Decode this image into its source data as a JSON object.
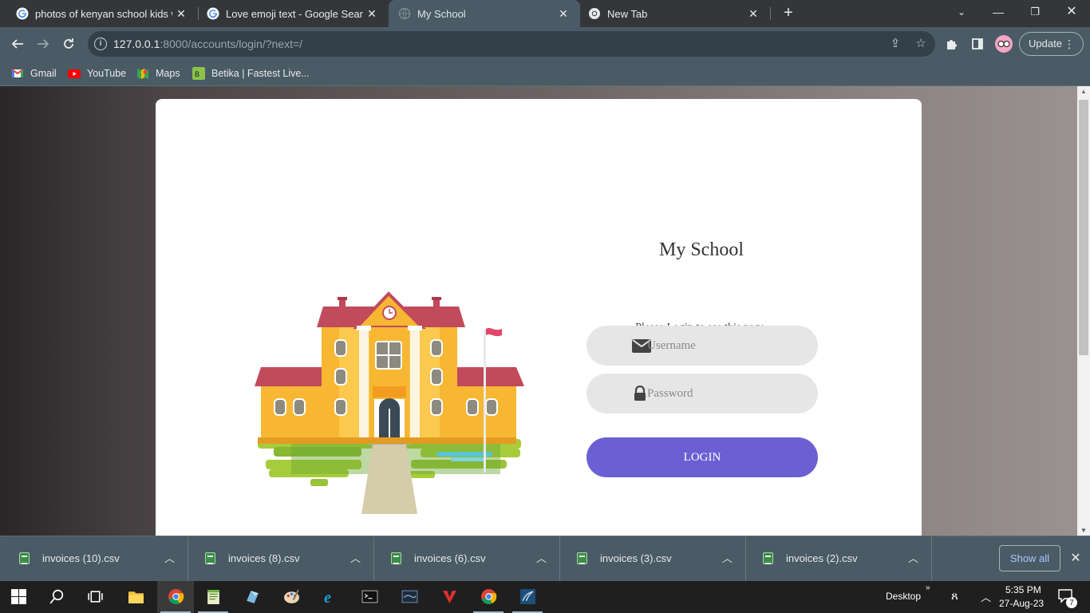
{
  "browser": {
    "tabs": [
      {
        "title": "photos of kenyan school kids wit",
        "favicon": "google-icon",
        "active": false
      },
      {
        "title": "Love emoji text - Google Search",
        "favicon": "google-icon",
        "active": false
      },
      {
        "title": "My School",
        "favicon": "globe-icon",
        "active": true
      },
      {
        "title": "New Tab",
        "favicon": "chrome-icon",
        "active": false
      }
    ],
    "url_host": "127.0.0.1",
    "url_path": ":8000/accounts/login/?next=/",
    "update_label": "Update",
    "bookmarks": [
      {
        "label": "Gmail",
        "icon": "gmail-icon"
      },
      {
        "label": "YouTube",
        "icon": "youtube-icon"
      },
      {
        "label": "Maps",
        "icon": "maps-icon"
      },
      {
        "label": "Betika | Fastest Live...",
        "icon": "betika-icon"
      }
    ]
  },
  "login": {
    "title": "My School",
    "message": "Please Login to see this page.",
    "username_placeholder": "Username",
    "password_placeholder": "Password",
    "button_label": "LOGIN"
  },
  "downloads": {
    "items": [
      {
        "name": "invoices (10).csv"
      },
      {
        "name": "invoices (8).csv"
      },
      {
        "name": "invoices (6).csv"
      },
      {
        "name": "invoices (3).csv"
      },
      {
        "name": "invoices (2).csv"
      }
    ],
    "show_all_label": "Show all"
  },
  "taskbar": {
    "desktop_label": "Desktop",
    "time": "5:35 PM",
    "date": "27-Aug-23",
    "notification_count": "7",
    "apps": [
      "windows-start-icon",
      "search-icon",
      "task-view-icon",
      "file-explorer-icon",
      "chrome-icon",
      "notepad-icon",
      "app-icon",
      "paint-icon",
      "internet-explorer-icon",
      "terminal-icon",
      "mysql-icon",
      "editor-icon",
      "chrome-icon",
      "workbench-icon"
    ]
  },
  "colors": {
    "accent": "#6a60d4",
    "chrome_frame": "#4a5b65"
  }
}
